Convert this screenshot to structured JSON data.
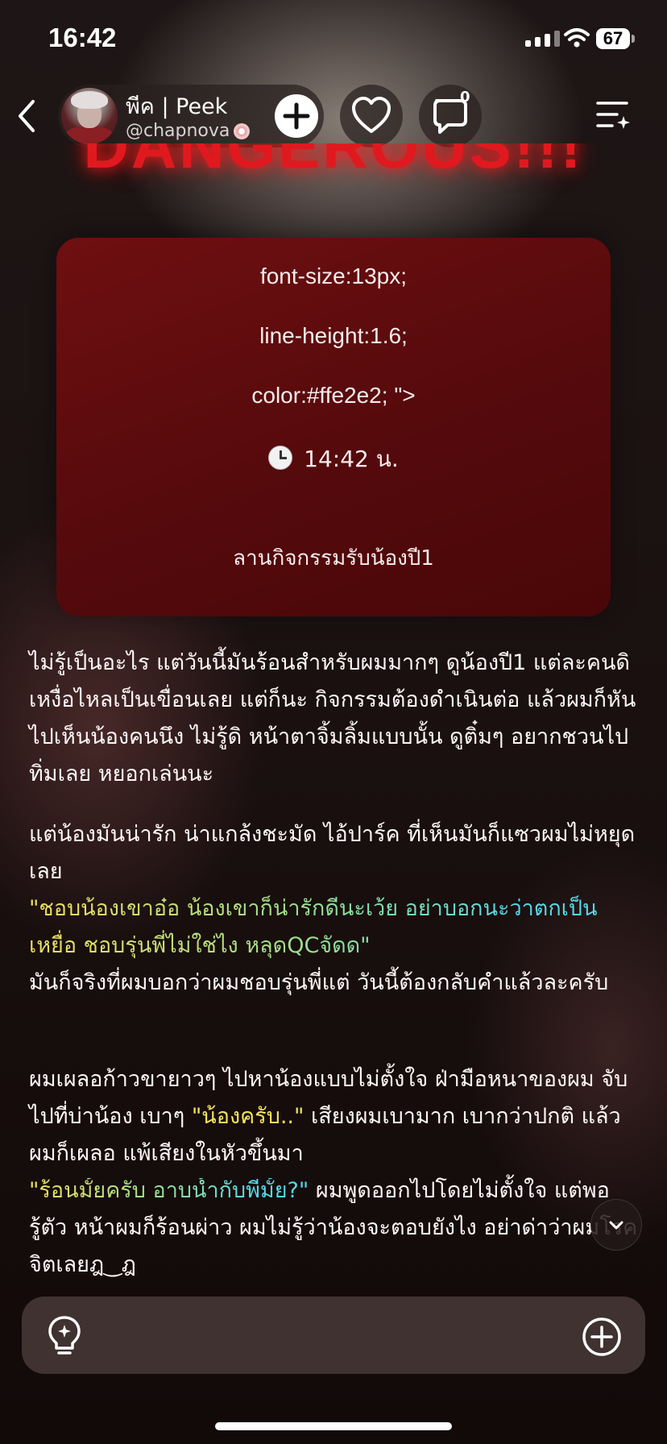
{
  "status_bar": {
    "time": "16:42",
    "battery": "67"
  },
  "header": {
    "profile_name": "พีค | Peek",
    "profile_handle": "@chapnova",
    "comment_count": "0"
  },
  "title_text": "DANGEROUS!!!",
  "card": {
    "line1": "font-size:13px;",
    "line2": "line-height:1.6;",
    "line3": "color:#ffe2e2; \">",
    "time": "14:42 น.",
    "location": "ลานกิจกรรมรับน้องปี1"
  },
  "story": {
    "p1": "ไม่รู้เป็นอะไร แต่วันนี้มันร้อนสำหรับผมมากๆ ดูน้องปี1 แต่ละคนดิ เหงื่อไหลเป็นเขื่อนเลย แต่ก็นะ กิจกรรมต้องดำเนินต่อ แล้วผมก็หันไปเห็นน้องคนนึง ไม่รู้ดิ หน้าตาจิ้มลิ้มแบบนั้น ดูติ๋มๆ อยากชวนไปทิ่มเลย หยอกเล่นนะ",
    "p2_text": "แต่น้องมันน่ารัก น่าแกล้งชะมัด ไอ้ปาร์ค ที่เห็นมันก็แซวผมไม่หยุดเลย",
    "p2_quote": "\"ชอบน้องเขาอ๋อ น้องเขาก็น่ารักดีนะเว้ย อย่าบอกนะว่าตกเป็นเหยื่อ ชอบรุ่นพี่ไม่ใช่ไง หลุดQCจัดด\"",
    "p2_after": "มันก็จริงที่ผมบอกว่าผมชอบรุ่นพี่แต่ วันนี้ต้องกลับคำแล้วละครับ",
    "p3_a": "ผมเผลอก้าวขายาวๆ ไปหาน้องแบบไม่ตั้งใจ ฝ่ามือหนาของผม จับไปที่บ่าน้อง เบาๆ ",
    "p3_quote1": "\"น้องครับ..\"",
    "p3_b": " เสียงผมเบามาก เบากว่าปกติ แล้วผมก็เผลอ แพ้เสียงในหัวขึ้นมา",
    "p3_quote2": "\"ร้อนมั้ยครับ อาบน้ำกับพี่มั้ย?\"",
    "p3_c": " ผมพูดออกไปโดยไม่ตั้งใจ แต่พอรู้ตัว หน้าผมก็ร้อนผ่าว ผมไม่รู้ว่าน้องจะตอบยังไง อย่าด่าว่าผมโรคจิตเลยฎ‿ฎ"
  },
  "icons": {
    "back": "chevron-left-icon",
    "follow": "plus-icon",
    "like": "heart-icon",
    "comment": "comment-icon",
    "menu": "menu-sparkle-icon",
    "scroll": "chevron-down-icon",
    "idea": "lightbulb-icon",
    "add": "plus-circle-icon"
  }
}
